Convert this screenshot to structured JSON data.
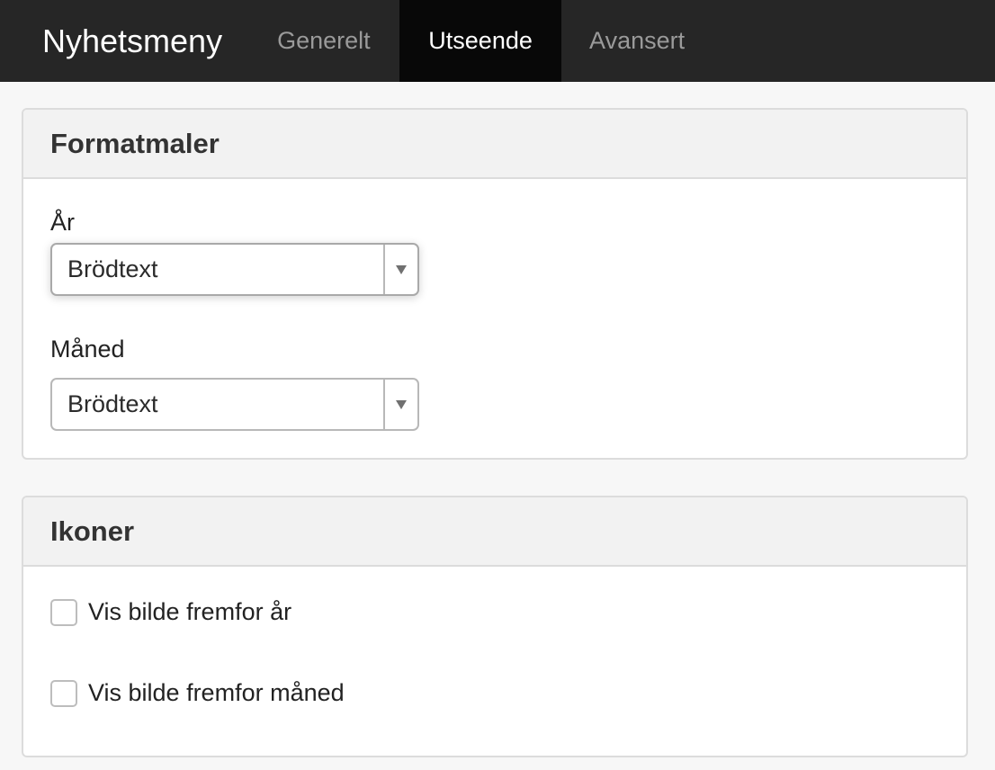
{
  "navbar": {
    "brand": "Nyhetsmeny",
    "tabs": [
      {
        "label": "Generelt",
        "active": false
      },
      {
        "label": "Utseende",
        "active": true
      },
      {
        "label": "Avansert",
        "active": false
      }
    ]
  },
  "formatmaler": {
    "heading": "Formatmaler",
    "year": {
      "label": "År",
      "value": "Brödtext"
    },
    "month": {
      "label": "Måned",
      "value": "Brödtext"
    }
  },
  "ikoner": {
    "heading": "Ikoner",
    "options": [
      {
        "label": "Vis bilde fremfor år",
        "checked": false
      },
      {
        "label": "Vis bilde fremfor måned",
        "checked": false
      }
    ]
  },
  "icons": {
    "dropdown": "chevron-down-icon"
  },
  "colors": {
    "navbar_bg": "#262626",
    "active_tab_bg": "#080808",
    "panel_heading_bg": "#f2f2f2"
  }
}
